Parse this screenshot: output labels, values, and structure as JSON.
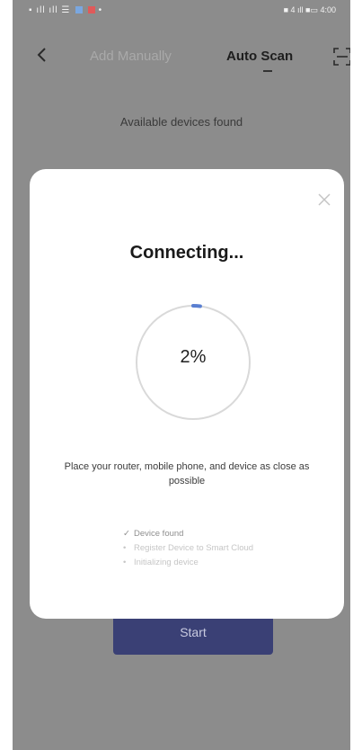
{
  "status_bar": {
    "left_text": "",
    "right_text": "■ 4 ıll ■▭ 4:00"
  },
  "nav": {
    "tab_manual": "Add Manually",
    "tab_auto": "Auto Scan"
  },
  "main": {
    "found_text": "Available devices found",
    "start_button_label": "Start"
  },
  "dialog": {
    "title": "Connecting...",
    "progress_text": "2%",
    "progress_value": 0.02,
    "hint": "Place your router, mobile phone, and device as close as possible",
    "steps": [
      {
        "mark": "✓",
        "label": "Device found"
      },
      {
        "mark": "•",
        "label": "Register Device to Smart Cloud"
      },
      {
        "mark": "•",
        "label": "Initializing device"
      }
    ]
  },
  "colors": {
    "backdrop": "#8c8c8c",
    "dialog_bg": "#ffffff",
    "button_bg": "#3a4075",
    "progress_accent": "#5a7fd1",
    "progress_track": "#d9d9d9"
  }
}
